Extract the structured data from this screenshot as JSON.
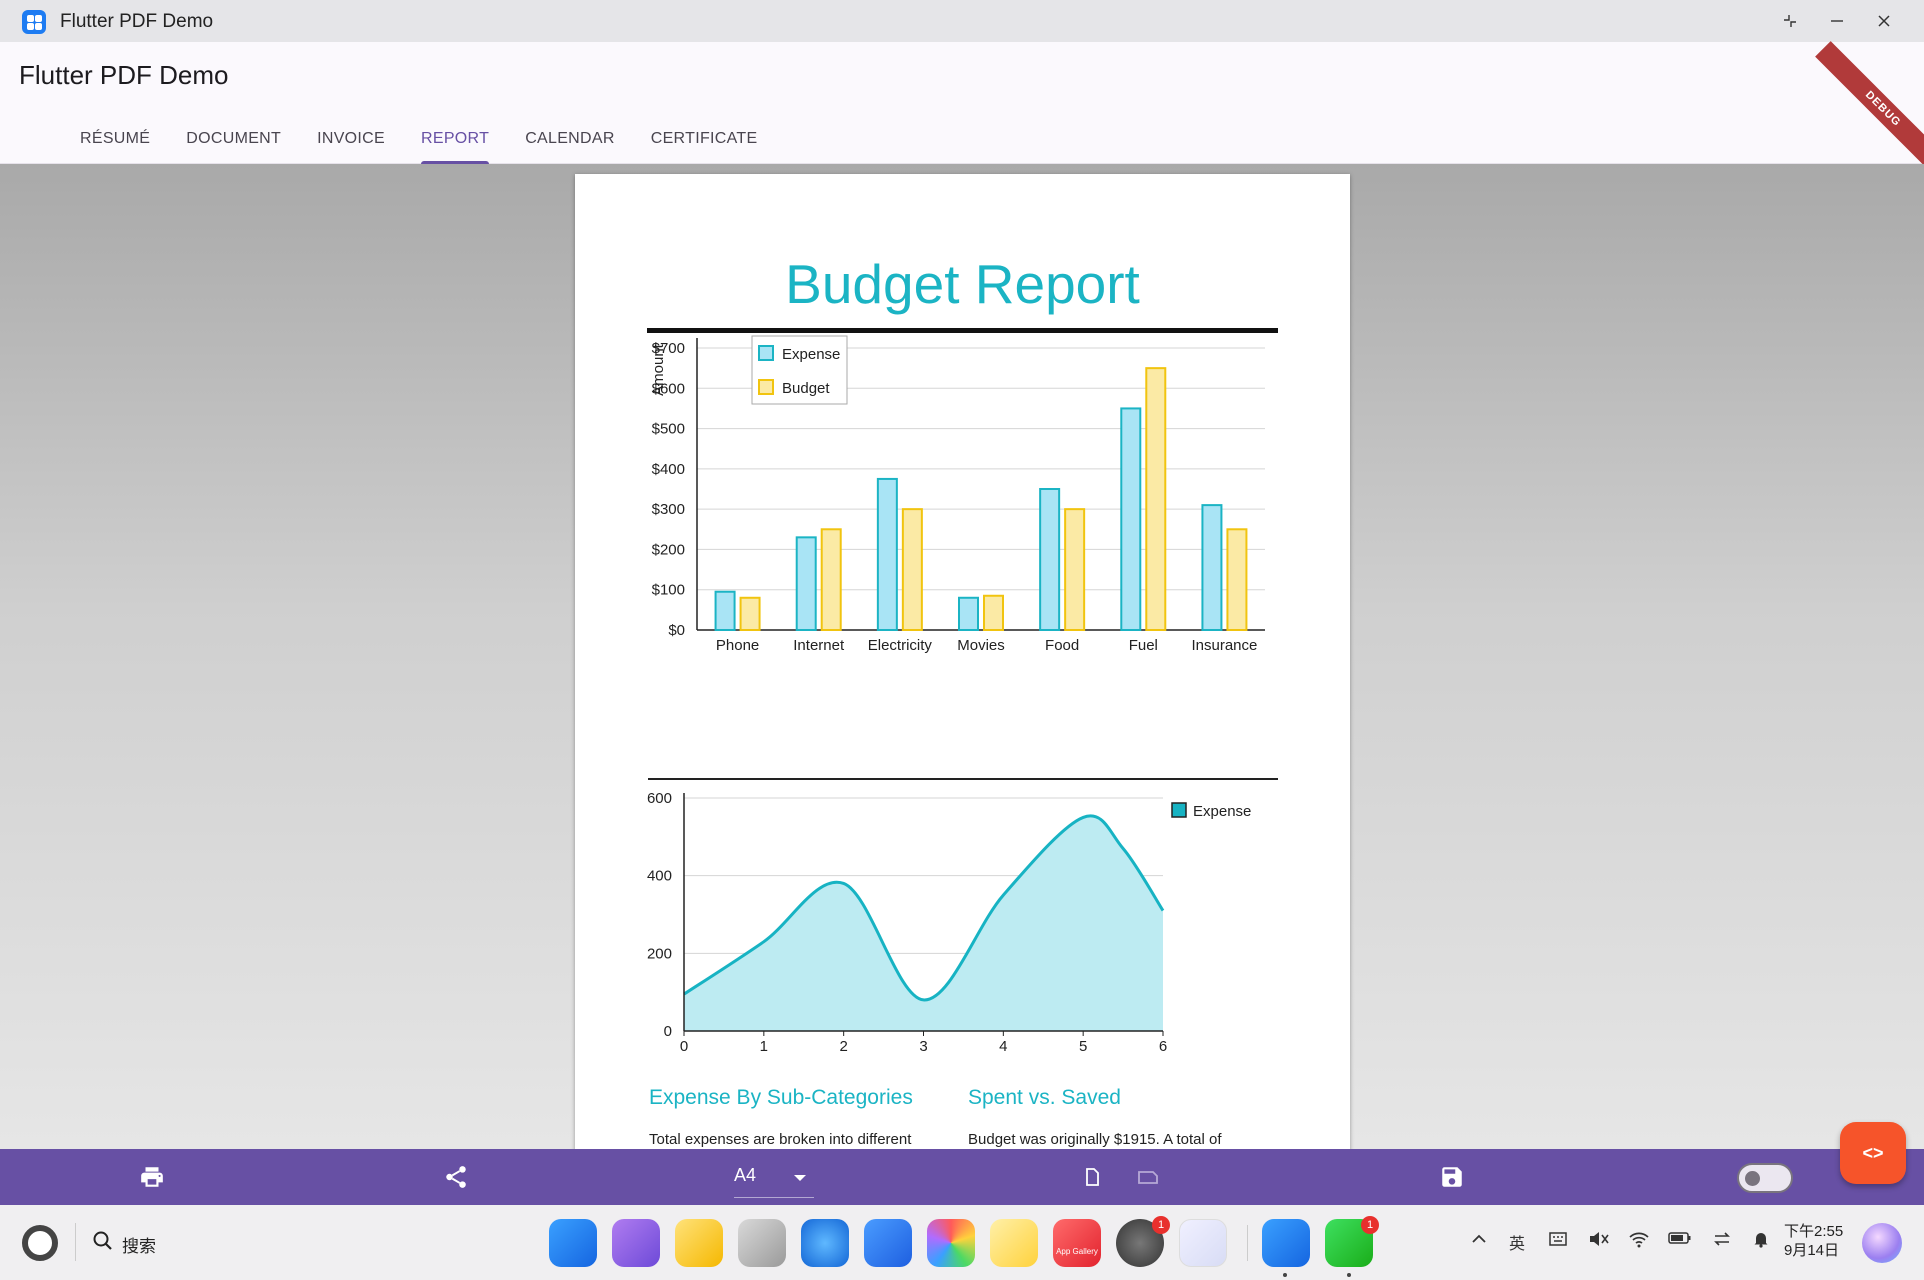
{
  "window": {
    "title": "Flutter PDF Demo",
    "controls": {
      "restore": "restore-icon",
      "minimize": "minimize-icon",
      "close": "close-icon"
    }
  },
  "appbar": {
    "title": "Flutter PDF Demo",
    "debug_banner": "DEBUG",
    "tabs": [
      {
        "label": "RÉSUMÉ"
      },
      {
        "label": "DOCUMENT"
      },
      {
        "label": "INVOICE"
      },
      {
        "label": "REPORT"
      },
      {
        "label": "CALENDAR"
      },
      {
        "label": "CERTIFICATE"
      }
    ],
    "active_tab": "REPORT",
    "accent_color": "#6750a4"
  },
  "report": {
    "title": "Budget Report",
    "title_color": "#1bb4c4",
    "sections": [
      {
        "title": "Expense By Sub-Categories",
        "text": "Total expenses are broken into different"
      },
      {
        "title": "Spent vs. Saved",
        "text": "Budget was originally $1915. A total of"
      }
    ]
  },
  "chart_data": [
    {
      "type": "bar",
      "ylabel": "Amount",
      "categories": [
        "Phone",
        "Internet",
        "Electricity",
        "Movies",
        "Food",
        "Fuel",
        "Insurance"
      ],
      "series": [
        {
          "name": "Expense",
          "color": "#a9e4f5",
          "stroke": "#1bb4c4",
          "values": [
            95,
            230,
            375,
            80,
            350,
            550,
            310
          ]
        },
        {
          "name": "Budget",
          "color": "#fbeaa5",
          "stroke": "#f1c40f",
          "values": [
            80,
            250,
            300,
            85,
            300,
            650,
            250
          ]
        }
      ],
      "ylim": [
        0,
        700
      ],
      "yticks": [
        "$0",
        "$100",
        "$200",
        "$300",
        "$400",
        "$500",
        "$600",
        "$700"
      ],
      "grid": true,
      "legend": "top-left"
    },
    {
      "type": "area",
      "series": [
        {
          "name": "Expense",
          "color": "#bdebf2",
          "stroke": "#17b3c3",
          "x": [
            0,
            1,
            2,
            3,
            4,
            5,
            5.5,
            6
          ],
          "values": [
            95,
            230,
            380,
            80,
            350,
            550,
            470,
            310
          ]
        }
      ],
      "xlim": [
        0,
        6
      ],
      "ylim": [
        0,
        600
      ],
      "xticks": [
        "0",
        "1",
        "2",
        "3",
        "4",
        "5",
        "6"
      ],
      "yticks": [
        "0",
        "200",
        "400",
        "600"
      ],
      "grid": true,
      "legend": "top-right"
    }
  ],
  "toolbar": {
    "print_icon": "print-icon",
    "share_icon": "share-icon",
    "page_size": "A4",
    "portrait_icon": "portrait-icon",
    "landscape_icon": "landscape-icon",
    "save_icon": "save-icon",
    "fab_label": "<>"
  },
  "taskbar": {
    "search_label": "搜索",
    "app_gallery_label": "App Gallery",
    "settings_badge": "1",
    "wechat_badge": "1",
    "ime_label": "英",
    "time": "下午2:55",
    "date": "9月14日"
  }
}
